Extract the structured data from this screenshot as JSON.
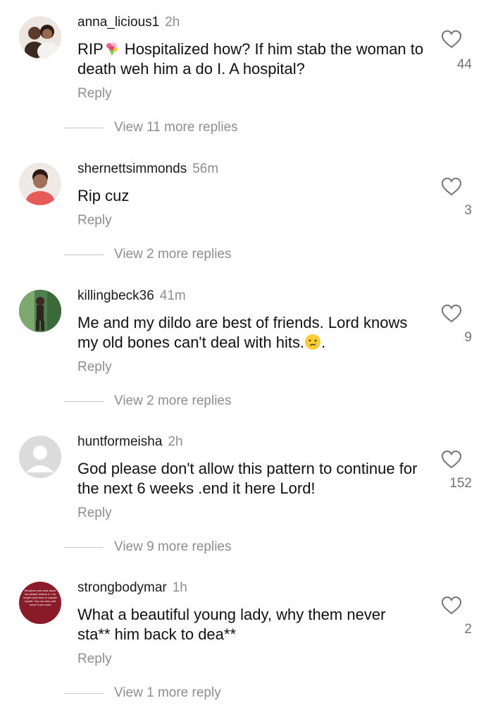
{
  "comments": [
    {
      "username": "anna_licious1",
      "time": "2h",
      "text_before": "RIP",
      "emoji_name": "bouquet-emoji",
      "text_after": " Hospitalized how? If him stab the woman to death weh him a do I. A hospital?",
      "likes": "44",
      "reply_label": "Reply",
      "view_more": "View 11 more replies"
    },
    {
      "username": "shernettsimmonds",
      "time": "56m",
      "text": "Rip cuz",
      "likes": "3",
      "reply_label": "Reply",
      "view_more": "View 2 more replies"
    },
    {
      "username": "killingbeck36",
      "time": "41m",
      "text_before": "Me and my dildo are best of friends. Lord knows my old bones can't deal with hits.",
      "emoji_name": "crying-face-emoji",
      "text_after": ".",
      "likes": "9",
      "reply_label": "Reply",
      "view_more": "View 2 more replies"
    },
    {
      "username": "huntformeisha",
      "time": "2h",
      "text": "God please don't allow this pattern to continue for the next 6 weeks .end it here Lord!",
      "likes": "152",
      "reply_label": "Reply",
      "view_more": "View 9 more replies"
    },
    {
      "username": "strongbodymar",
      "time": "1h",
      "text": "What a beautiful young lady, why them never sta** him back to dea**",
      "avatar_text": "Whatever you hear about me please believe it. I no longer have time to explain myself. You can also add some if you want",
      "likes": "2",
      "reply_label": "Reply",
      "view_more": "View 1 more reply"
    }
  ],
  "icons": {
    "like": "heart-outline-icon"
  },
  "colors": {
    "secondary_text": "#8e8e8e",
    "primary_text": "#111111",
    "divider": "#c7c7c7"
  }
}
